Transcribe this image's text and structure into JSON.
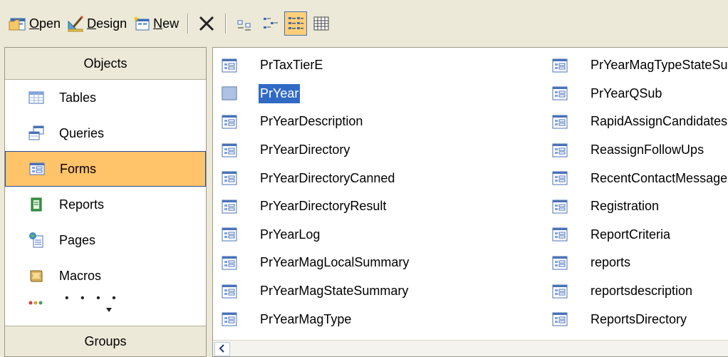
{
  "toolbar": {
    "open_label": "Open",
    "design_label": "Design",
    "new_label": "New"
  },
  "objects": {
    "header": "Objects",
    "items": [
      {
        "label": "Tables",
        "icon": "table-icon"
      },
      {
        "label": "Queries",
        "icon": "query-icon"
      },
      {
        "label": "Forms",
        "icon": "form-icon"
      },
      {
        "label": "Reports",
        "icon": "report-icon"
      },
      {
        "label": "Pages",
        "icon": "page-icon"
      },
      {
        "label": "Macros",
        "icon": "macro-icon"
      }
    ],
    "selected": "Forms",
    "groups_header": "Groups"
  },
  "list": {
    "column1": [
      "PrTaxTierE",
      "PrYear",
      "PrYearDescription",
      "PrYearDirectory",
      "PrYearDirectoryCanned",
      "PrYearDirectoryResult",
      "PrYearLog",
      "PrYearMagLocalSummary",
      "PrYearMagStateSummary",
      "PrYearMagType"
    ],
    "column2": [
      "PrYearMagTypeStateSummary",
      "PrYearQSub",
      "RapidAssignCandidates",
      "ReassignFollowUps",
      "RecentContactMessages",
      "Registration",
      "ReportCriteria",
      "reports",
      "reportsdescription",
      "ReportsDirectory"
    ],
    "selected": "PrYear"
  },
  "colors": {
    "selected_nav_bg": "#ffc369",
    "selected_item_bg": "#316ac5"
  }
}
